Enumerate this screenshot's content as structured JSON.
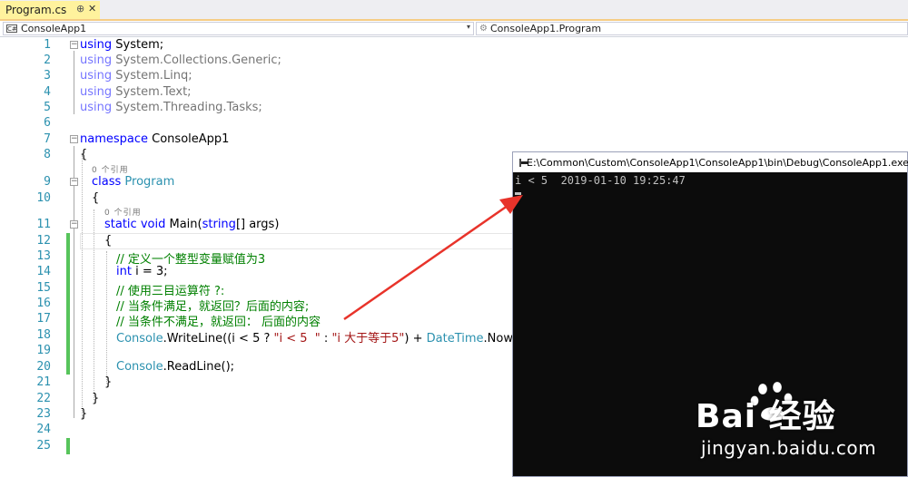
{
  "tab": {
    "title": "Program.cs",
    "pin_glyph": "⊕",
    "close_glyph": "✕"
  },
  "nav": {
    "project": "ConsoleApp1",
    "member": "ConsoleApp1.Program"
  },
  "editor": {
    "line_numbers": [
      "1",
      "2",
      "3",
      "4",
      "5",
      "6",
      "7",
      "8",
      "9",
      "10",
      "11",
      "12",
      "13",
      "14",
      "15",
      "16",
      "17",
      "18",
      "19",
      "20",
      "21",
      "22",
      "23",
      "24",
      "25"
    ],
    "codelens_class": "0 个引用",
    "codelens_main": "0 个引用",
    "tokens": {
      "using": "using",
      "ns_system": "System;",
      "ns_collections": "System.Collections.Generic;",
      "ns_linq": "System.Linq;",
      "ns_text": "System.Text;",
      "ns_tasks": "System.Threading.Tasks;",
      "namespace_kw": "namespace",
      "namespace_name": "ConsoleApp1",
      "open_brace": "{",
      "close_brace": "}",
      "class_kw": "class",
      "class_name": "Program",
      "static_kw": "static",
      "void_kw": "void",
      "main_name": "Main(",
      "string_kw": "string",
      "main_args": "[] args)",
      "comment_1": "// 定义一个整型变量赋值为3",
      "int_kw": "int",
      "int_decl": " i = 3;",
      "comment_2": "// 使用三目运算符 ?:",
      "comment_3": "// 当条件满足，就返回？后面的内容;",
      "comment_4": "// 当条件不满足，就返回： 后面的内容",
      "console_cls": "Console",
      "writeline": ".WriteLine((i < 5 ? ",
      "str_lt": "\"i < 5  \"",
      "colon": " : ",
      "str_ge": "\"i 大于等于5\"",
      "plus": ") + ",
      "datetime_cls": "DateTime",
      "now": ".Now);",
      "readline": ".ReadLine();"
    }
  },
  "console_window": {
    "title": "E:\\Common\\Custom\\ConsoleApp1\\ConsoleApp1\\bin\\Debug\\ConsoleApp1.exe",
    "output": "i < 5  2019-01-10 19:25:47"
  },
  "watermark": {
    "brand": "Bai  经验",
    "site": "jingyan.baidu.com"
  },
  "colors": {
    "keyword": "#0000ff",
    "type": "#2b91af",
    "string": "#a31515",
    "comment": "#008000",
    "line_number": "#2b91af",
    "change_bar": "#57c45b",
    "tab_active": "#fff29d",
    "arrow": "#e8332a"
  }
}
